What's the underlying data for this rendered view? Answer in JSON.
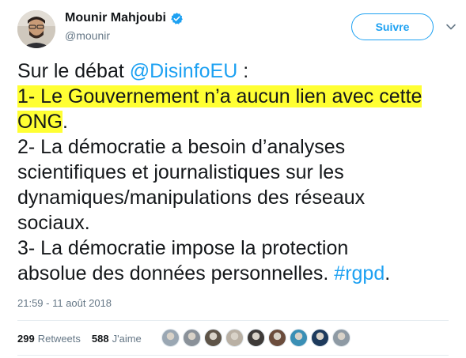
{
  "user": {
    "name": "Mounir Mahjoubi",
    "handle": "@mounir",
    "follow_label": "Suivre"
  },
  "tweet": {
    "lines": [
      {
        "pre": "Sur le débat ",
        "mention": "@DisinfoEU",
        "post": " :"
      },
      {
        "text": "1- Le Gouvernement n’a aucun lien avec cette",
        "highlight": true
      },
      {
        "text": "ONG",
        "post": ".",
        "highlight": true
      },
      {
        "text": "2- La démocratie a besoin d’analyses"
      },
      {
        "text": "scientifiques et journalistiques sur les"
      },
      {
        "text": "dynamiques/manipulations des réseaux"
      },
      {
        "text": "sociaux."
      },
      {
        "text": "3- La démocratie impose la protection"
      },
      {
        "text": "absolue des données personnelles. ",
        "hashtag": "#rgpd",
        "post": "."
      }
    ],
    "timestamp": "21:59 - 11 août 2018"
  },
  "stats": {
    "retweets_count": "299",
    "retweets_label": "Retweets",
    "likes_count": "588",
    "likes_label": "J'aime"
  },
  "likers": [
    {
      "name": "liker-1",
      "color": "#9aa7b3"
    },
    {
      "name": "liker-2",
      "color": "#8a9199"
    },
    {
      "name": "liker-3",
      "color": "#5e5448"
    },
    {
      "name": "liker-4",
      "color": "#b9b0a4"
    },
    {
      "name": "liker-5",
      "color": "#3e3a38"
    },
    {
      "name": "liker-6",
      "color": "#6b4c3c"
    },
    {
      "name": "liker-7",
      "color": "#3a8fb5"
    },
    {
      "name": "liker-8",
      "color": "#1d3a5c"
    },
    {
      "name": "liker-9",
      "color": "#8e9aa4"
    }
  ],
  "colors": {
    "accent": "#1da1f2",
    "highlight": "#ffff33",
    "muted": "#657786"
  },
  "icons": {
    "verified": "verified-badge-icon",
    "caret": "chevron-down-icon"
  }
}
